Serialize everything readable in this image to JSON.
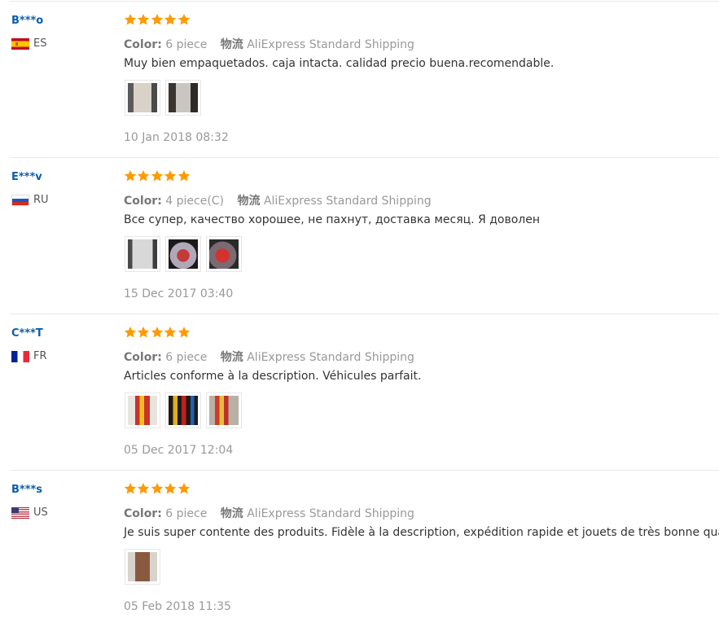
{
  "labels": {
    "color": "Color:",
    "shipping": "物流"
  },
  "reviews": [
    {
      "user": "B***o",
      "country": "ES",
      "flag_icon": "spain-flag-icon",
      "rating": 5,
      "color": "6 piece",
      "shipping": "AliExpress Standard Shipping",
      "text": "Muy bien empaquetados. caja intacta. calidad precio buena.recomendable.",
      "photos": 2,
      "date": "10 Jan 2018 08:32"
    },
    {
      "user": "E***v",
      "country": "RU",
      "flag_icon": "russia-flag-icon",
      "rating": 5,
      "color": "4 piece(C)",
      "shipping": "AliExpress Standard Shipping",
      "text": "Все супер, качество хорошее, не пахнут, доставка месяц. Я доволен",
      "photos": 3,
      "date": "15 Dec 2017 03:40"
    },
    {
      "user": "C***T",
      "country": "FR",
      "flag_icon": "france-flag-icon",
      "rating": 5,
      "color": "6 piece",
      "shipping": "AliExpress Standard Shipping",
      "text": "Articles conforme à la description. Véhicules parfait.",
      "photos": 3,
      "date": "05 Dec 2017 12:04"
    },
    {
      "user": "B***s",
      "country": "US",
      "flag_icon": "usa-flag-icon",
      "rating": 5,
      "color": "6 piece",
      "shipping": "AliExpress Standard Shipping",
      "text": "Je suis super contente des produits. Fidèle à la description, expédition rapide et jouets de très bonne qualité.",
      "photos": 1,
      "date": "05 Feb 2018 11:35"
    }
  ],
  "colors": {
    "star": "#ff9a00",
    "username": "#0d5ea8",
    "muted": "#999999"
  }
}
